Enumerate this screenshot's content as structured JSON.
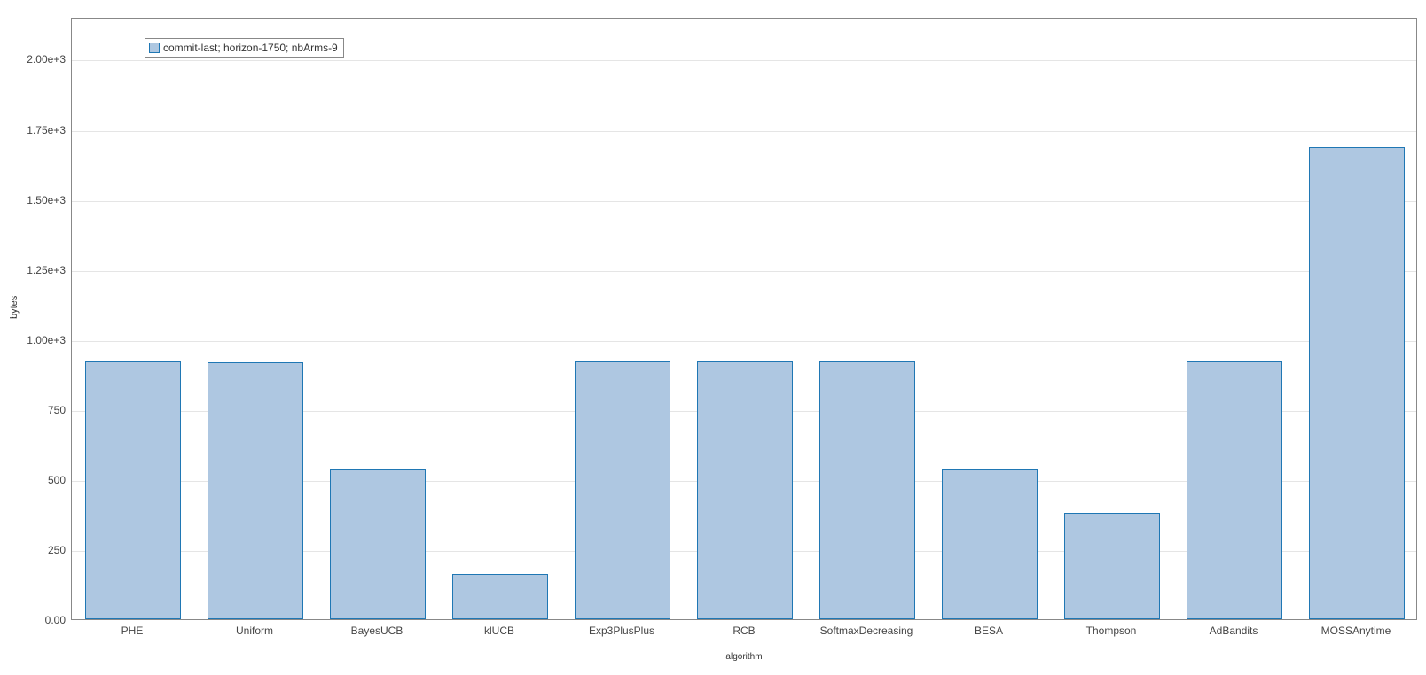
{
  "chart_data": {
    "type": "bar",
    "categories": [
      "PHE",
      "Uniform",
      "BayesUCB",
      "klUCB",
      "Exp3PlusPlus",
      "RCB",
      "SoftmaxDecreasing",
      "BESA",
      "Thompson",
      "AdBandits",
      "MOSSAnytime"
    ],
    "values": [
      920,
      918,
      535,
      160,
      920,
      920,
      920,
      535,
      380,
      920,
      1685
    ],
    "title": "",
    "xlabel": "algorithm",
    "ylabel": "bytes",
    "ylim": [
      0,
      2150
    ],
    "yticks": [
      0,
      250,
      500,
      750,
      1000,
      1250,
      1500,
      1750,
      2000
    ],
    "ytick_labels": [
      "0.00",
      "250",
      "500",
      "750",
      "1.00e+3",
      "1.25e+3",
      "1.50e+3",
      "1.75e+3",
      "2.00e+3"
    ],
    "legend": "commit-last; horizon-1750; nbArms-9"
  }
}
